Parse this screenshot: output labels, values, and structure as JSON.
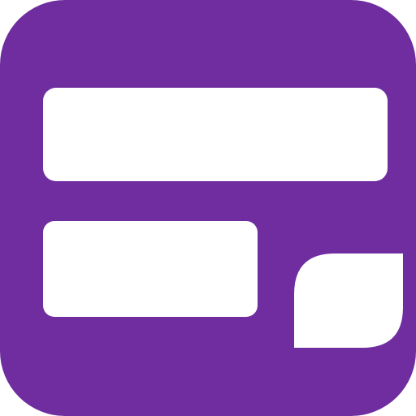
{
  "icon": {
    "name": "app-icon",
    "background_color": "#6f2da0",
    "foreground_color": "#ffffff"
  }
}
